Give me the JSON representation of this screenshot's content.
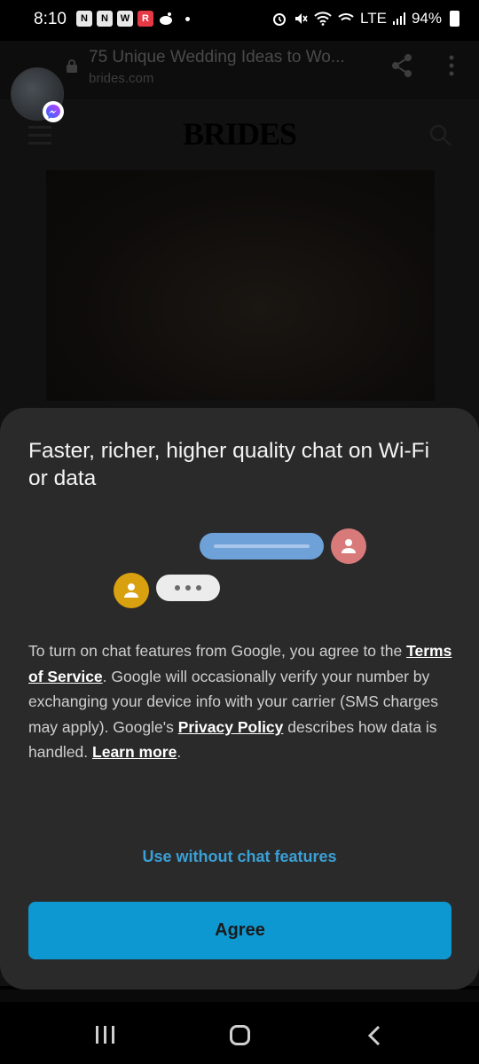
{
  "status_bar": {
    "time": "8:10",
    "app_icons": [
      "N",
      "N",
      "W",
      "R"
    ],
    "network": "LTE",
    "battery": "94%"
  },
  "browser": {
    "page_title": "75 Unique Wedding Ideas to Wo...",
    "domain": "brides.com"
  },
  "page": {
    "logo": "BRIDES"
  },
  "dialog": {
    "title": "Faster, richer, higher quality chat on Wi-Fi or data",
    "body_part1": "To turn on chat features from Google, you agree to the ",
    "terms_link": "Terms of Service",
    "body_part2": ". Google will occasionally verify your number by exchanging your device info with your carrier (SMS charges may apply). Google's ",
    "privacy_link": "Privacy Policy",
    "body_part3": " describes how data is handled. ",
    "learn_more_link": "Learn more",
    "body_part4": ".",
    "secondary_button": "Use without chat features",
    "primary_button": "Agree"
  },
  "colors": {
    "sheet_bg": "#2a2a2b",
    "accent": "#0e98d2",
    "link_secondary": "#3aa0d6",
    "outgoing_bubble": "#6fa1d9",
    "avatar_pink": "#d87a7a",
    "avatar_yellow": "#d9a010"
  }
}
